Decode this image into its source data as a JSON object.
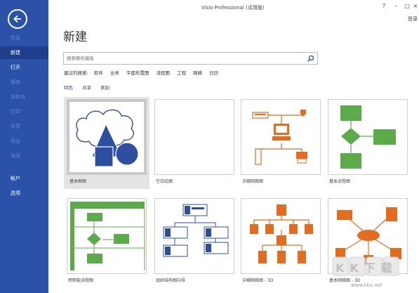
{
  "window": {
    "title": "Visio Professional (试用版)",
    "controls": [
      "?",
      "–",
      "□",
      "×"
    ],
    "login_label": "登录"
  },
  "sidebar": {
    "items": [
      {
        "label": "信息",
        "state": "disabled"
      },
      {
        "label": "新建",
        "state": "active"
      },
      {
        "label": "打开",
        "state": "normal"
      },
      {
        "label": "保存",
        "state": "disabled"
      },
      {
        "label": "另存为",
        "state": "disabled"
      },
      {
        "label": "打印",
        "state": "disabled"
      },
      {
        "label": "共享",
        "state": "disabled"
      },
      {
        "label": "导出",
        "state": "disabled"
      },
      {
        "label": "关闭",
        "state": "disabled"
      },
      {
        "label": "帐户",
        "state": "normal"
      },
      {
        "label": "选项",
        "state": "normal"
      }
    ]
  },
  "main": {
    "title": "新建",
    "search": {
      "placeholder": "搜索联机模板"
    },
    "suggested": {
      "label": "建议的搜索:",
      "items": [
        "软件",
        "业务",
        "平面布置图",
        "流程图",
        "工程",
        "网络",
        "日历"
      ]
    },
    "tabs": [
      {
        "label": "特色",
        "active": true
      },
      {
        "label": "共享",
        "active": false
      },
      {
        "label": "类别",
        "active": false
      }
    ],
    "templates": [
      {
        "name": "基本框图",
        "icon": "basic-diagram-thumb",
        "selected": true
      },
      {
        "name": "空白绘图",
        "icon": "blank-drawing-thumb",
        "selected": false
      },
      {
        "name": "详细网络图",
        "icon": "network-diagram-thumb",
        "selected": false
      },
      {
        "name": "基本流程图",
        "icon": "basic-flowchart-thumb",
        "selected": false
      },
      {
        "name": "跨职能流程图",
        "icon": "cross-functional-thumb",
        "selected": false
      },
      {
        "name": "组织结构图向导",
        "icon": "org-chart-thumb",
        "selected": false
      },
      {
        "name": "详细网络图 - 3D",
        "icon": "network-3d-thumb",
        "selected": false
      },
      {
        "name": "基本网络图 - 3D",
        "icon": "basic-network-3d-thumb",
        "selected": false
      }
    ]
  },
  "watermark": {
    "text": "KK下载",
    "url": "www.kkx.net"
  },
  "colors": {
    "sidebar": "#2b52a8",
    "shape_blue": "#2e4fa0",
    "network_orange": "#e46c1f",
    "flow_green": "#5cab4a"
  }
}
